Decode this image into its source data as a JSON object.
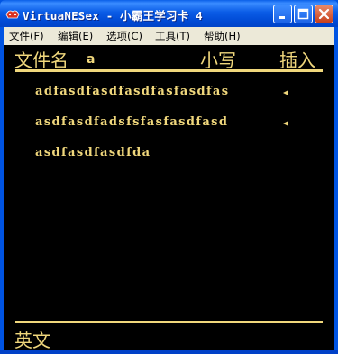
{
  "window": {
    "title": "VirtuaNESex - 小霸王学习卡 4"
  },
  "menu": {
    "items": [
      {
        "label": "文件(F)"
      },
      {
        "label": "编辑(E)"
      },
      {
        "label": "选项(C)"
      },
      {
        "label": "工具(T)"
      },
      {
        "label": "帮助(H)"
      }
    ]
  },
  "screen": {
    "header": {
      "filename_label": "文件名",
      "filename_value": "a",
      "case_label": "小写",
      "mode_label": "插入"
    },
    "rows": [
      "adfasdfasdfasdfasfasdfas",
      "asdfasdfadsfsfasfasdfasd",
      "asdfasdfasdfda"
    ],
    "footer": {
      "language_label": "英文"
    }
  },
  "colors": {
    "screen_text": "#F0D77C",
    "screen_bg": "#000000",
    "titlebar": "#0054E3",
    "menubar": "#ECE9D8"
  }
}
